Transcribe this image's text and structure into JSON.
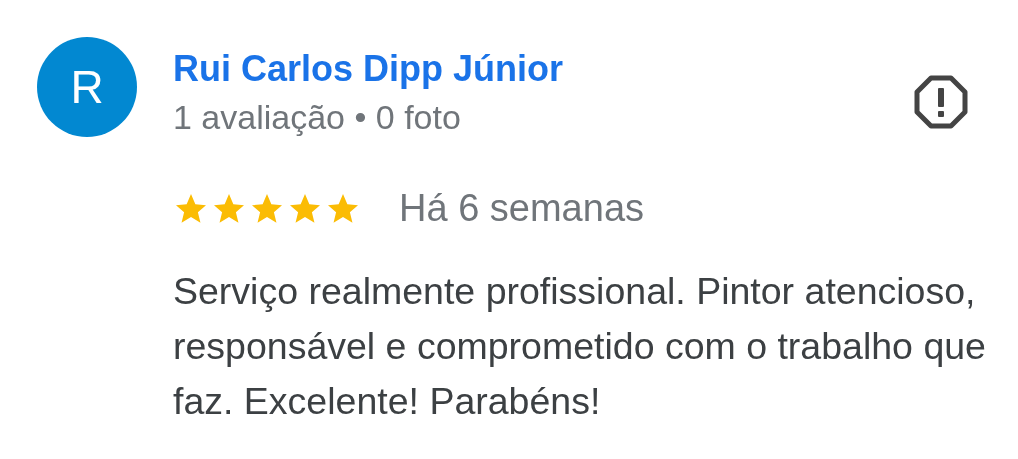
{
  "review": {
    "avatar_letter": "R",
    "author": "Rui Carlos Dipp Júnior",
    "author_meta": "1 avaliação • 0 foto",
    "stars": 5,
    "time": "Há 6 semanas",
    "text": "Serviço realmente profissional. Pintor atencioso, responsável e comprometido com o trabalho que faz. Excelente! Parabéns!"
  }
}
